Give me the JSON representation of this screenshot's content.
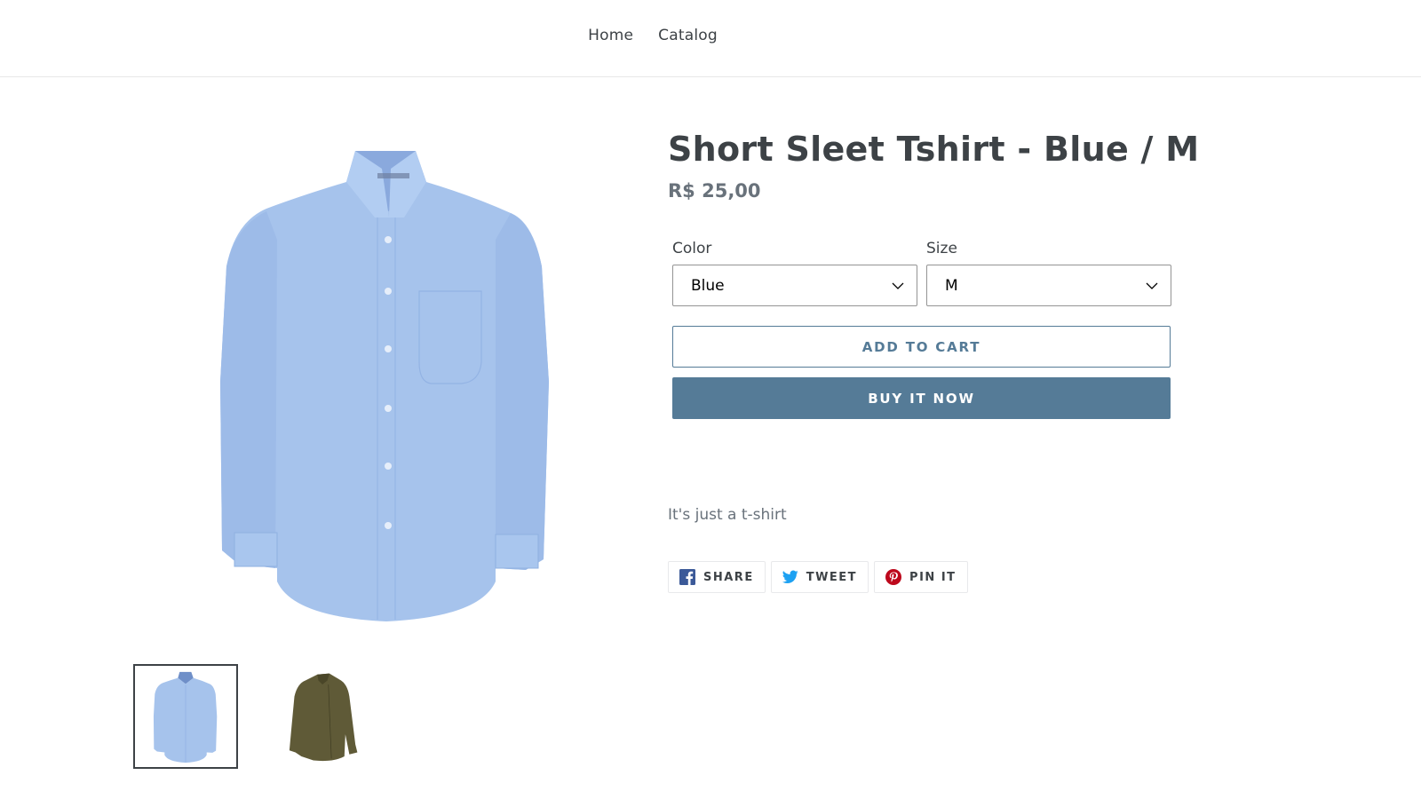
{
  "nav": {
    "items": [
      {
        "label": "Home"
      },
      {
        "label": "Catalog"
      }
    ]
  },
  "product": {
    "title": "Short Sleet Tshirt - Blue / M",
    "price": "R$ 25,00",
    "description": "It's just a t-shirt",
    "main_image": "blue-dress-shirt",
    "thumbnails": [
      {
        "name": "blue-dress-shirt",
        "active": true
      },
      {
        "name": "olive-shirt",
        "active": false
      }
    ]
  },
  "options": {
    "color": {
      "label": "Color",
      "value": "Blue"
    },
    "size": {
      "label": "Size",
      "value": "M"
    }
  },
  "buttons": {
    "add_to_cart": "ADD TO CART",
    "buy_now": "BUY IT NOW"
  },
  "social": [
    {
      "label": "SHARE",
      "icon": "facebook-icon"
    },
    {
      "label": "TWEET",
      "icon": "twitter-icon"
    },
    {
      "label": "PIN IT",
      "icon": "pinterest-icon"
    }
  ],
  "colors": {
    "accent": "#557b97",
    "text": "#3d4246",
    "muted": "#69727b",
    "facebook": "#3b5998",
    "twitter": "#1da1f2",
    "pinterest": "#bd081c"
  }
}
